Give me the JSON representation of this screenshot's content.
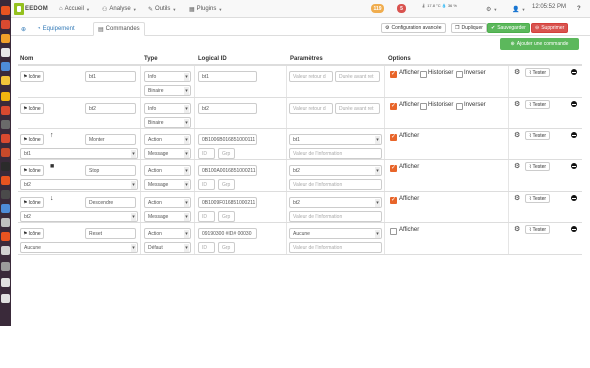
{
  "nav": {
    "logo_text": "EEDOM",
    "menus": [
      {
        "icon": "⌂",
        "label": "Accueil"
      },
      {
        "icon": "⚇",
        "label": "Analyse"
      },
      {
        "icon": "✎",
        "label": "Outils"
      },
      {
        "icon": "▦",
        "label": "Plugins"
      }
    ],
    "badge_orange": "119",
    "badge_red": "5",
    "weather_temp": "17.8 °C",
    "weather_humidity": "36 %",
    "time": "12:05:52 PM",
    "help": "?"
  },
  "tabs": {
    "add_icon": "⊕",
    "equipment": "Equipement",
    "commands": "Commandes"
  },
  "header_buttons": {
    "advanced": "Configuration avancée",
    "duplicate": "Dupliquer",
    "save": "Sauvegarder",
    "delete": "Supprimer"
  },
  "add_command": "Ajouter une commande",
  "table": {
    "headers": {
      "name": "Nom",
      "type": "Type",
      "logical_id": "Logical ID",
      "params": "Paramètres",
      "options": "Options"
    },
    "icon_btn_label": "Icône",
    "test_label": "Tester",
    "opt_afficher": "Afficher",
    "opt_historiser": "Historiser",
    "opt_inverser": "Inverser",
    "ph_retour": "Valeur retour d",
    "ph_duree": "Durée avant ret",
    "ph_info": "Valeur de l'information",
    "ph_id": "ID",
    "ph_grp": "Grp",
    "rows": [
      {
        "name": "bt1",
        "type": "Info",
        "subtype": "Binaire",
        "logical_id": "bt1",
        "afficher": true,
        "historiser": false,
        "inverser": false
      },
      {
        "name": "bt2",
        "type": "Info",
        "subtype": "Binaire",
        "logical_id": "bt2",
        "afficher": true,
        "historiser": false,
        "inverser": false
      },
      {
        "name": "Monter",
        "dir_icon": "↑",
        "type": "Action",
        "subtype": "Message",
        "logical_id": "0B1006B016851000111",
        "value_select": "bt1",
        "link_select": "bt1",
        "afficher": true
      },
      {
        "name": "Stop",
        "dir_icon": "■",
        "type": "Action",
        "subtype": "Message",
        "logical_id": "0B100A0016851000211",
        "value_select": "bt2",
        "link_select": "bt2",
        "afficher": true
      },
      {
        "name": "Descendre",
        "dir_icon": "↓",
        "type": "Action",
        "subtype": "Message",
        "logical_id": "0B1009F016851000211",
        "value_select": "bt2",
        "link_select": "bt2",
        "afficher": true
      },
      {
        "name": "Reset",
        "type": "Action",
        "subtype": "Défaut",
        "logical_id": "09190300 #ID# 00030",
        "value_select": "Aucune",
        "link_select": "Aucune",
        "afficher": false
      }
    ]
  },
  "colors": {
    "green": "#5cb85c",
    "red": "#d9534f",
    "orange": "#e8652a",
    "link": "#337ab7"
  }
}
